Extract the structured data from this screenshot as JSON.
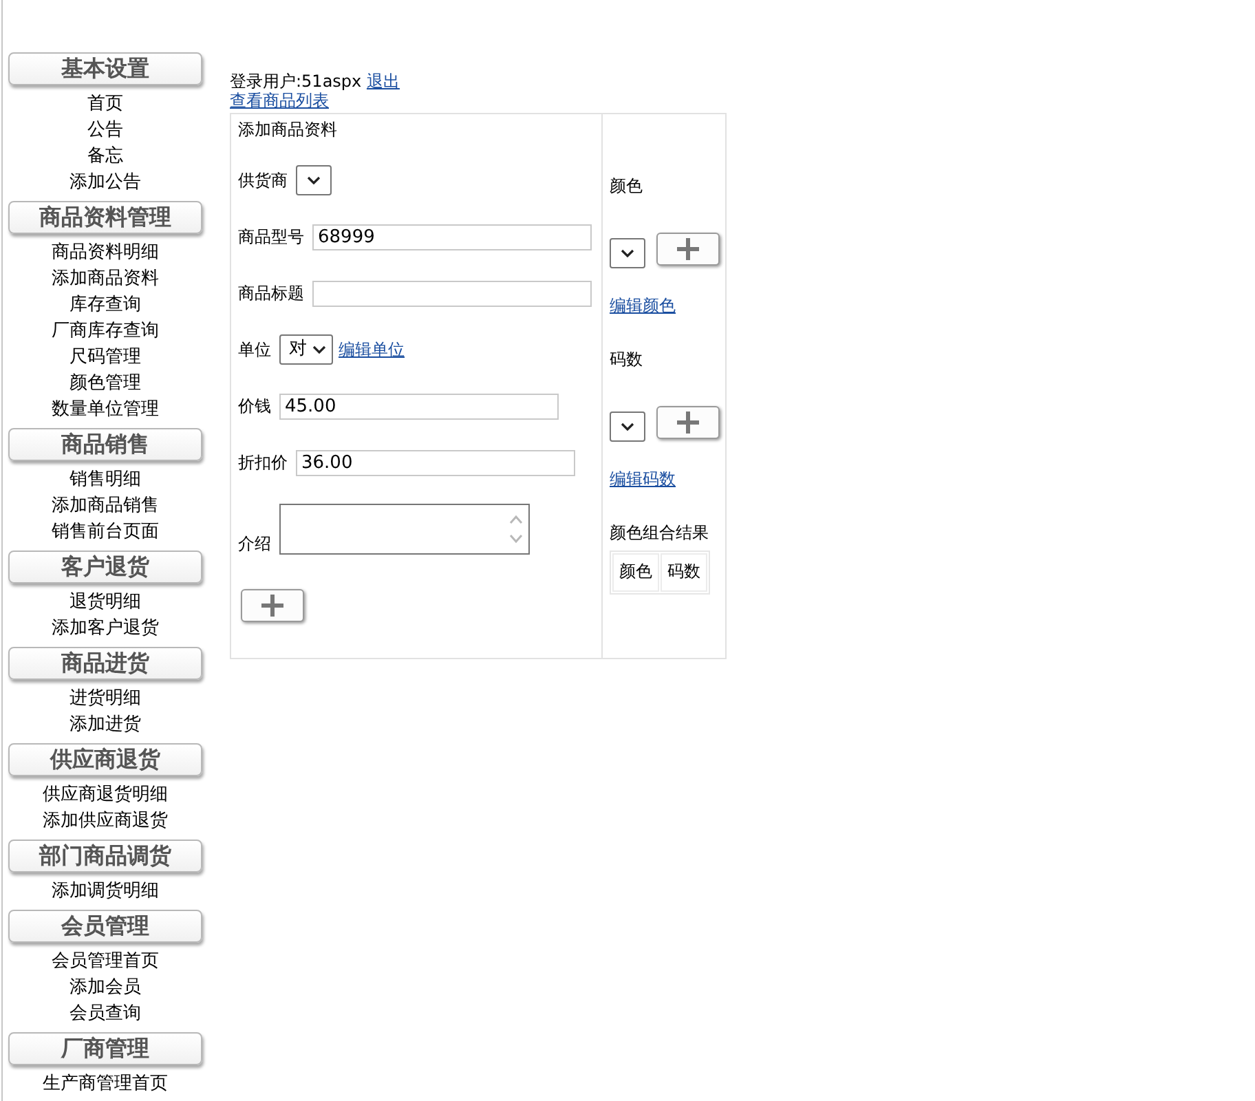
{
  "sidebar": {
    "sections": [
      {
        "title": "基本设置",
        "items": [
          "首页",
          "公告",
          "备忘",
          "添加公告"
        ]
      },
      {
        "title": "商品资料管理",
        "items": [
          "商品资料明细",
          "添加商品资料",
          "库存查询",
          "厂商库存查询",
          "尺码管理",
          "颜色管理",
          "数量单位管理"
        ]
      },
      {
        "title": "商品销售",
        "items": [
          "销售明细",
          "添加商品销售",
          "销售前台页面"
        ]
      },
      {
        "title": "客户退货",
        "items": [
          "退货明细",
          "添加客户退货"
        ]
      },
      {
        "title": "商品进货",
        "items": [
          "进货明细",
          "添加进货"
        ]
      },
      {
        "title": "供应商退货",
        "items": [
          "供应商退货明细",
          "添加供应商退货"
        ]
      },
      {
        "title": "部门商品调货",
        "items": [
          "添加调货明细"
        ]
      },
      {
        "title": "会员管理",
        "items": [
          "会员管理首页",
          "添加会员",
          "会员查询"
        ]
      },
      {
        "title": "厂商管理",
        "items": [
          "生产商管理首页"
        ]
      }
    ]
  },
  "user_bar": {
    "user_text": "登录用户:51aspx",
    "logout_link": "退出",
    "list_link": "查看商品列表"
  },
  "product_form": {
    "title": "添加商品资料",
    "fields": [
      {
        "kind": "select",
        "label": "供货商"
      },
      {
        "kind": "text",
        "label": "商品型号",
        "value": "68999"
      },
      {
        "kind": "text",
        "label": "商品标题"
      },
      {
        "kind": "select",
        "label": "单位",
        "value": "对",
        "link": "编辑单位"
      },
      {
        "kind": "text",
        "label": "价钱",
        "value": "45.00"
      },
      {
        "kind": "text",
        "label": "折扣价",
        "value": "36.00"
      },
      {
        "kind": "textarea",
        "label": "介绍"
      },
      {
        "kind": "add_button"
      }
    ]
  },
  "options_panel": {
    "groups": [
      {
        "label": "颜色",
        "link": "编辑颜色"
      },
      {
        "label": "码数",
        "link": "编辑码数"
      }
    ],
    "result_title": "颜色组合结果",
    "result_columns": [
      "颜色",
      "码数"
    ]
  }
}
